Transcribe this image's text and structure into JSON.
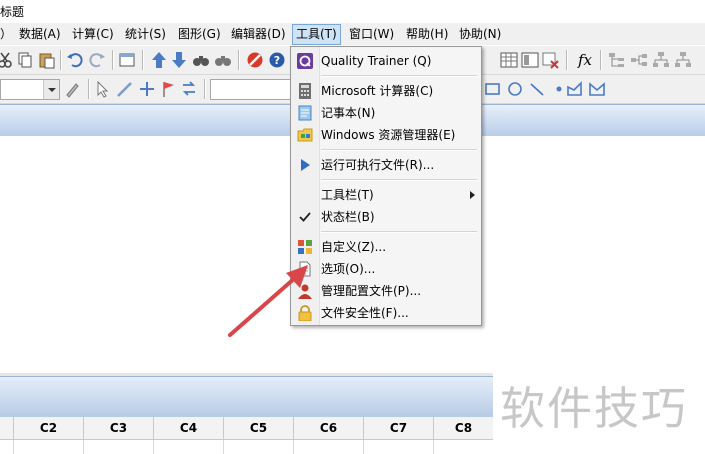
{
  "window": {
    "title": "标题"
  },
  "menu_bar": {
    "items": [
      {
        "label": "数据(A)"
      },
      {
        "label": "计算(C)"
      },
      {
        "label": "统计(S)"
      },
      {
        "label": "图形(G)"
      },
      {
        "label": "编辑器(D)"
      },
      {
        "label": "工具(T)"
      },
      {
        "label": "窗口(W)"
      },
      {
        "label": "帮助(H)"
      },
      {
        "label": "协助(N)"
      }
    ],
    "open_menu": "工具(T)"
  },
  "toolbar": {
    "formula_label": "fx"
  },
  "tools_menu": {
    "items": [
      {
        "label": "Quality Trainer (Q)",
        "icon": "quality-trainer-icon"
      },
      {
        "label": "Microsoft 计算器(C)",
        "icon": "calculator-icon"
      },
      {
        "label": "记事本(N)",
        "icon": "notepad-icon"
      },
      {
        "label": "Windows 资源管理器(E)",
        "icon": "windows-explorer-icon"
      },
      {
        "label": "运行可执行文件(R)...",
        "icon": "run-icon"
      },
      {
        "label": "工具栏(T)",
        "submenu": true
      },
      {
        "label": "状态栏(B)",
        "checked": true
      },
      {
        "label": "自定义(Z)...",
        "icon": "customize-icon"
      },
      {
        "label": "选项(O)...",
        "icon": "options-icon"
      },
      {
        "label": "管理配置文件(P)...",
        "icon": "profile-icon"
      },
      {
        "label": "文件安全性(F)...",
        "icon": "lock-icon"
      }
    ]
  },
  "worksheet": {
    "columns": [
      "C2",
      "C3",
      "C4",
      "C5",
      "C6",
      "C7",
      "C8"
    ]
  },
  "watermark": "软件技巧",
  "colors": {
    "annotation_arrow": "#d9464a",
    "menu_highlight": "#cfe3f7",
    "header_gradient_bottom": "#b9cde8"
  }
}
